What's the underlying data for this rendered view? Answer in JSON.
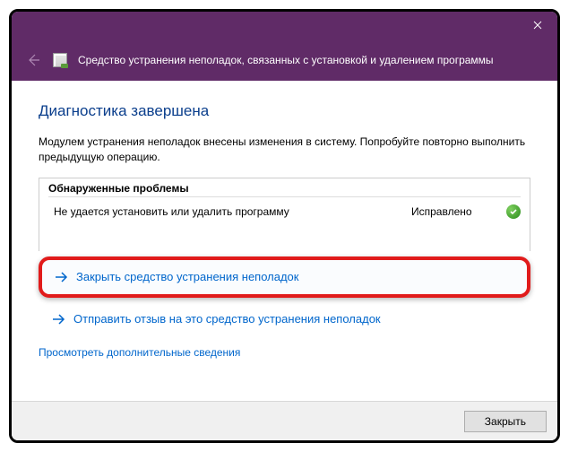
{
  "header": {
    "title": "Средство устранения неполадок, связанных с установкой и удалением программы"
  },
  "main": {
    "heading": "Диагностика завершена",
    "subtext": "Модулем устранения неполадок внесены изменения в систему. Попробуйте повторно выполнить предыдущую операцию.",
    "problems": {
      "header": "Обнаруженные проблемы",
      "items": [
        {
          "name": "Не удается установить или удалить программу",
          "status": "Исправлено"
        }
      ]
    },
    "actions": {
      "close_troubleshooter": "Закрыть средство устранения неполадок",
      "send_feedback": "Отправить отзыв на это средство устранения неполадок"
    },
    "info_link": "Просмотреть дополнительные сведения"
  },
  "footer": {
    "close_label": "Закрыть"
  }
}
